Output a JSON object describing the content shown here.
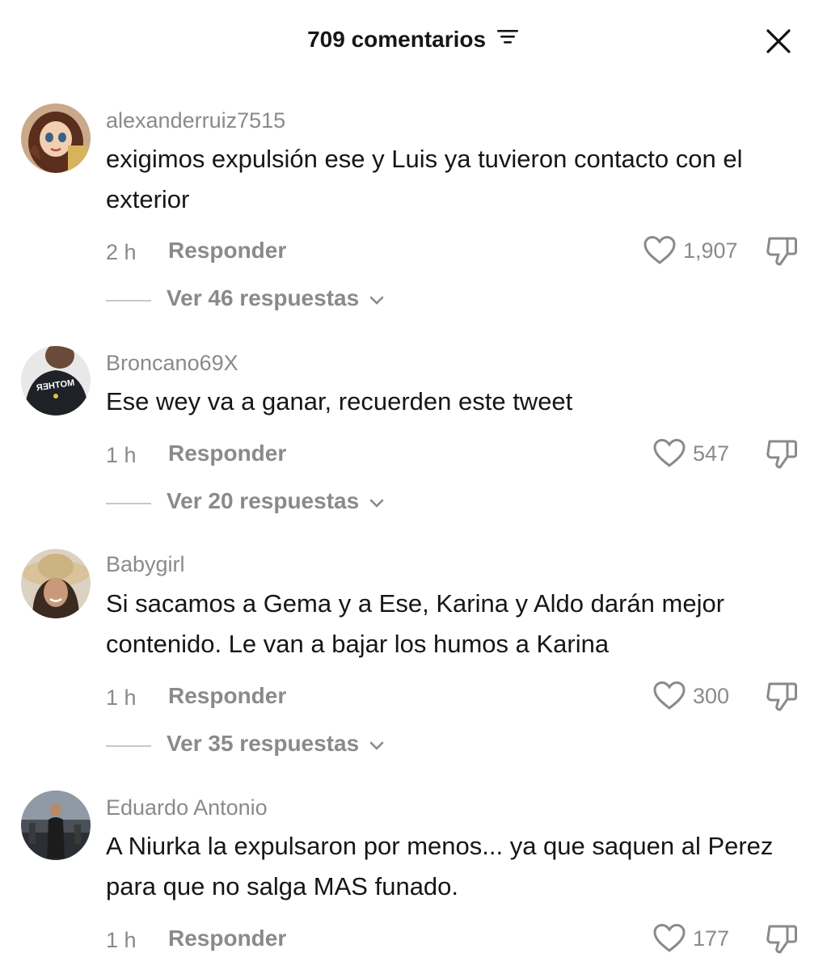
{
  "header": {
    "title": "709 comentarios",
    "sort_icon": "sort-lines-icon",
    "close_icon": "close-x-icon"
  },
  "comments": [
    {
      "username": "alexanderruiz7515",
      "text": "exigimos expulsión ese y Luis ya tuvieron contacto con el exterior",
      "time": "2 h",
      "reply_label": "Responder",
      "likes": "1,907",
      "replies_label": "Ver 46 respuestas"
    },
    {
      "username": "Broncano69X",
      "text": "Ese wey va a ganar, recuerden este tweet",
      "time": "1 h",
      "reply_label": "Responder",
      "likes": "547",
      "replies_label": "Ver 20 respuestas"
    },
    {
      "username": "Babygirl",
      "text": "Si sacamos a Gema y a Ese, Karina y Aldo darán mejor contenido. Le van a bajar los humos a Karina",
      "time": "1 h",
      "reply_label": "Responder",
      "likes": "300",
      "replies_label": "Ver 35 respuestas"
    },
    {
      "username": "Eduardo Antonio",
      "text": "A Niurka la expulsaron por menos... ya que saquen al Perez para que no salga MAS funado.",
      "time": "1 h",
      "reply_label": "Responder",
      "likes": "177"
    }
  ],
  "avatar_shirt_text": "MOTHER",
  "colors": {
    "text": "#161616",
    "muted": "#8a8a8a",
    "divider": "#c8c8c8",
    "background": "#ffffff"
  }
}
